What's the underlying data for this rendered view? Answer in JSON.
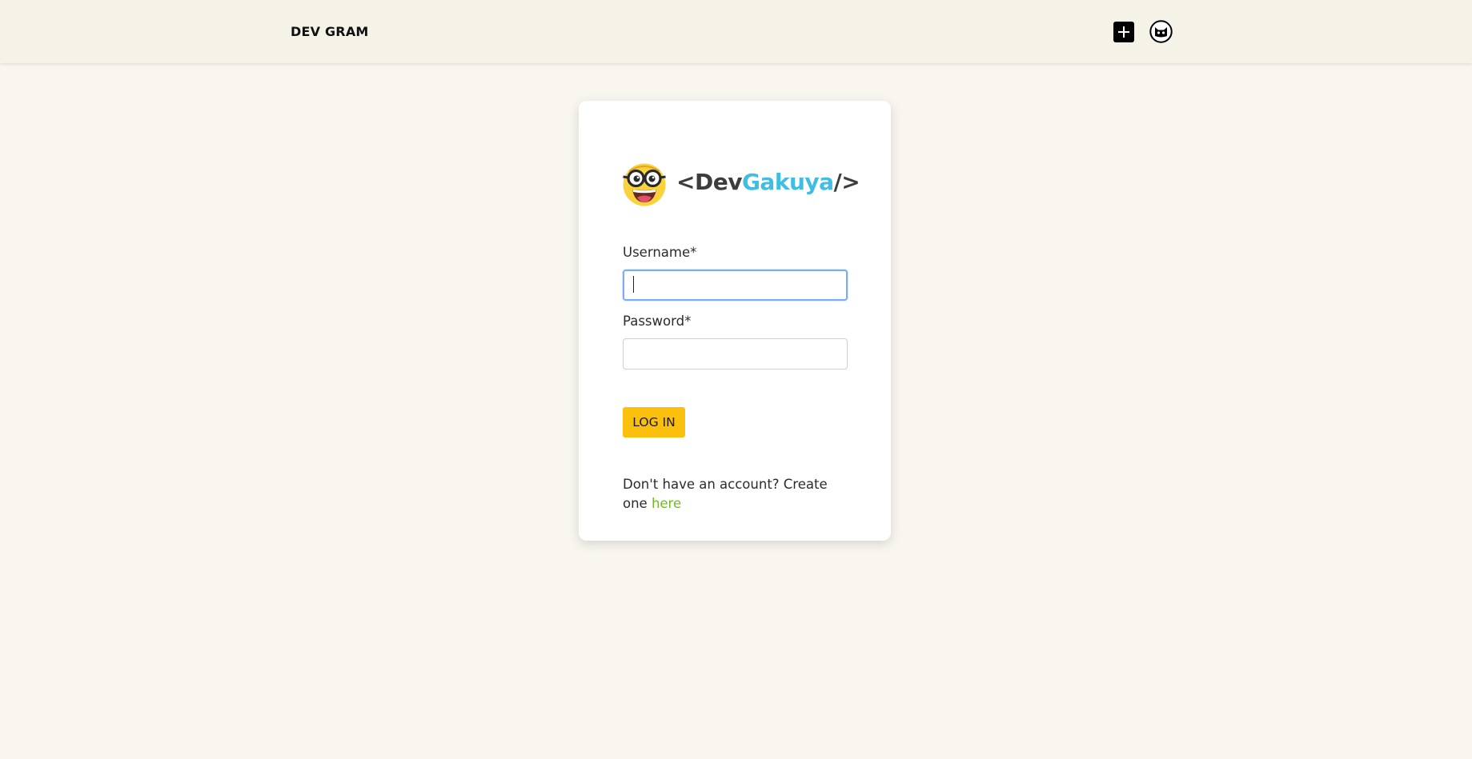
{
  "navbar": {
    "brand": "DEV GRAM",
    "add_icon": "plus-square-icon",
    "avatar_icon": "cat-avatar-icon"
  },
  "login_card": {
    "logo": {
      "open_bracket": "<",
      "word_dark": "Dev",
      "word_blue": "Gakuya",
      "close_bracket": "/>",
      "face_icon": "nerd-face-icon"
    },
    "username_label": "Username*",
    "username_value": "",
    "password_label": "Password*",
    "password_value": "",
    "login_button": "LOG IN",
    "signup_prefix": "Don't have an account? Create one ",
    "signup_link": "here"
  },
  "colors": {
    "page_bg": "#f8f6ef",
    "navbar_bg": "#f5f3e8",
    "button": "#fbbf0e",
    "link": "#74b72e",
    "logo_blue": "#3fbde3",
    "focus_ring": "#7aaef0"
  }
}
